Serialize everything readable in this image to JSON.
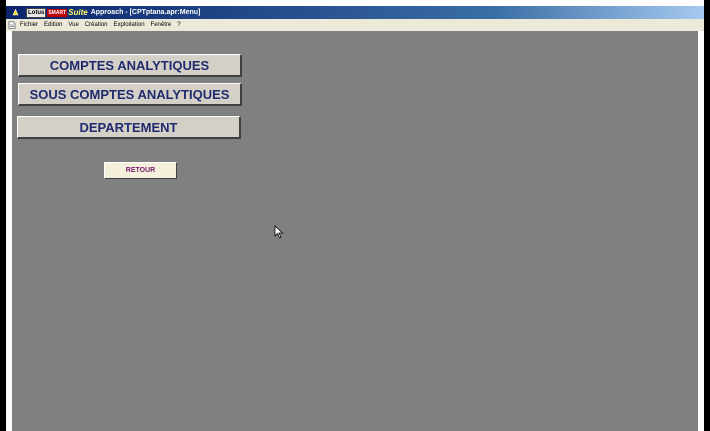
{
  "window": {
    "title_prefix": "Lotus",
    "title_smart": "SMART",
    "title_suite": "Suite",
    "title": "Approach - [CPTptana.apr:Menu]"
  },
  "menubar": {
    "items": [
      "Fichier",
      "Edition",
      "Vue",
      "Création",
      "Exploitation",
      "Fenêtre",
      "?"
    ]
  },
  "buttons": {
    "comptes": "COMPTES ANALYTIQUES",
    "sous_comptes": "SOUS COMPTES ANALYTIQUES",
    "departement": "DEPARTEMENT",
    "retour": "RETOUR"
  },
  "colors": {
    "workspace": "#808080",
    "button_text": "#1f2b6e",
    "retour_text": "#7a1a6e"
  },
  "icons": {
    "app": "approach-app-icon",
    "document": "document-icon",
    "cursor": "mouse-pointer-icon"
  }
}
